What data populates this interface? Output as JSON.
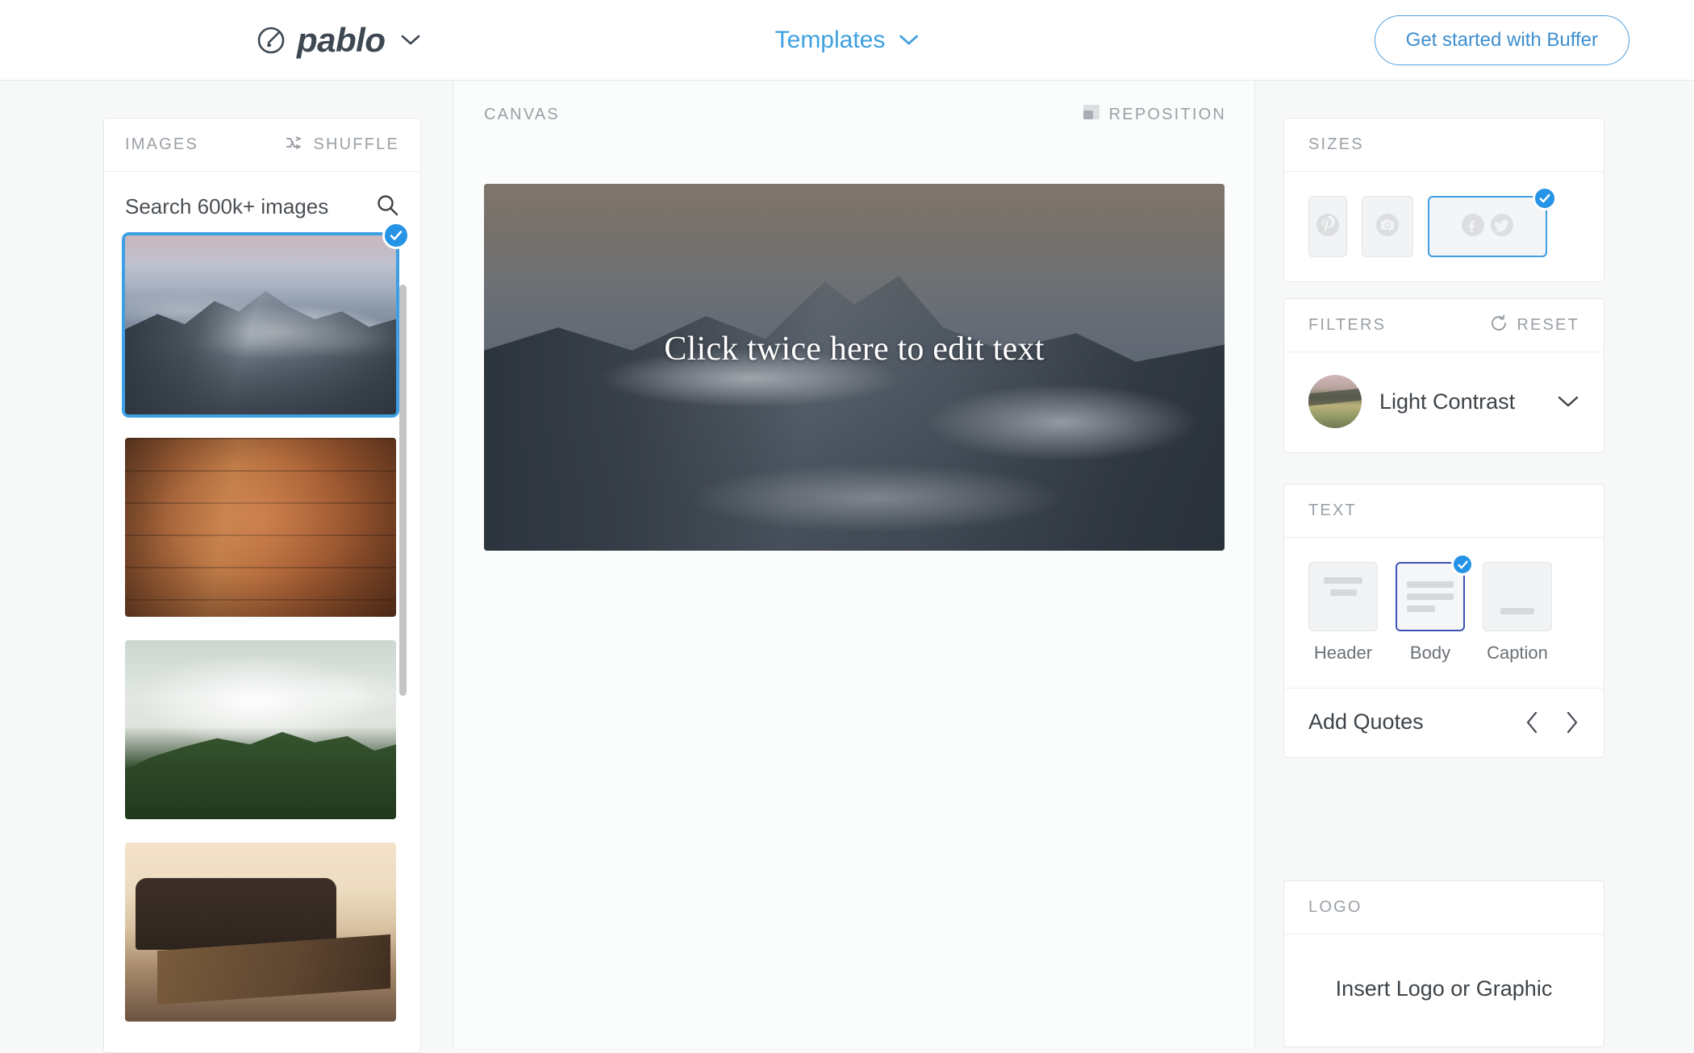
{
  "header": {
    "brand": "pablo",
    "brand_icon": "pablo-circle-brush-icon",
    "brand_chevron": "chevron-down-icon",
    "templates_label": "Templates",
    "templates_chevron": "chevron-down-icon",
    "cta_label": "Get started with Buffer",
    "accent_blue": "#3ea0e0"
  },
  "images_panel": {
    "title": "IMAGES",
    "shuffle_label": "SHUFFLE",
    "shuffle_icon": "shuffle-icon",
    "search_placeholder": "Search 600k+ images",
    "search_value": "",
    "search_icon": "search-icon",
    "selected_index": 0,
    "thumbnails": [
      {
        "name": "snowy-mountain-sunset",
        "selected": true
      },
      {
        "name": "wooden-planks",
        "selected": false
      },
      {
        "name": "green-mountain-clouds",
        "selected": false
      },
      {
        "name": "living-room-sofa-table",
        "selected": false
      }
    ]
  },
  "canvas_panel": {
    "title": "CANVAS",
    "reposition_label": "REPOSITION",
    "reposition_icon": "reposition-icon",
    "canvas_text": "Click twice here to edit text",
    "canvas_image": "snowy-mountain-sunset"
  },
  "sizes_panel": {
    "title": "SIZES",
    "options": [
      {
        "name": "pinterest",
        "icon": "pinterest-icon",
        "selected": false
      },
      {
        "name": "instagram",
        "icon": "instagram-icon",
        "selected": false
      },
      {
        "name": "facebook-twitter",
        "icon": "facebook-twitter-icon",
        "selected": true
      }
    ]
  },
  "filters_panel": {
    "title": "FILTERS",
    "reset_label": "RESET",
    "reset_icon": "reset-circular-arrow-icon",
    "selected_filter": "Light Contrast",
    "chevron_icon": "chevron-down-icon"
  },
  "text_panel": {
    "title": "TEXT",
    "options": [
      {
        "label": "Header",
        "selected": false
      },
      {
        "label": "Body",
        "selected": true
      },
      {
        "label": "Caption",
        "selected": false
      }
    ],
    "quotes_label": "Add Quotes",
    "prev_icon": "chevron-left-icon",
    "next_icon": "chevron-right-icon"
  },
  "logo_panel": {
    "title": "LOGO",
    "insert_label": "Insert Logo or Graphic"
  },
  "colors": {
    "accent": "#3e9fe5",
    "check_badge": "#2593e6",
    "text_selected_border": "#3f51b5",
    "muted_text": "#9aa0a6",
    "page_bg": "#f7f8f8"
  }
}
